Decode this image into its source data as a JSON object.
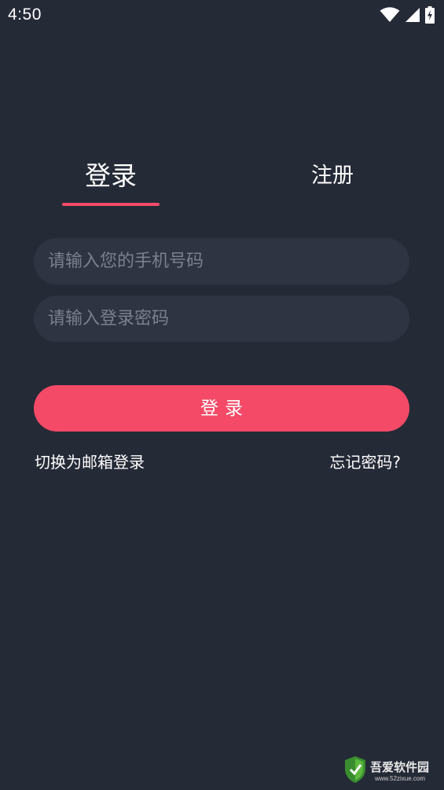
{
  "status_bar": {
    "time": "4:50",
    "icons": [
      "wifi-icon",
      "cellular-signal-icon",
      "battery-charging-icon"
    ]
  },
  "tabs": [
    {
      "label": "登录",
      "active": true
    },
    {
      "label": "注册",
      "active": false
    }
  ],
  "form": {
    "phone_placeholder": "请输入您的手机号码",
    "phone_value": "",
    "password_placeholder": "请输入登录密码",
    "password_value": "",
    "login_button_label": "登录"
  },
  "links": {
    "switch_to_email": "切换为邮箱登录",
    "forgot_password": "忘记密码?"
  },
  "watermark": {
    "text": "吾爱软件园",
    "url": "www.52zixue.com"
  },
  "colors": {
    "background": "#252a37",
    "input_background": "#2f3443",
    "accent": "#f44a67",
    "placeholder": "#7b808e",
    "text": "#ffffff"
  }
}
